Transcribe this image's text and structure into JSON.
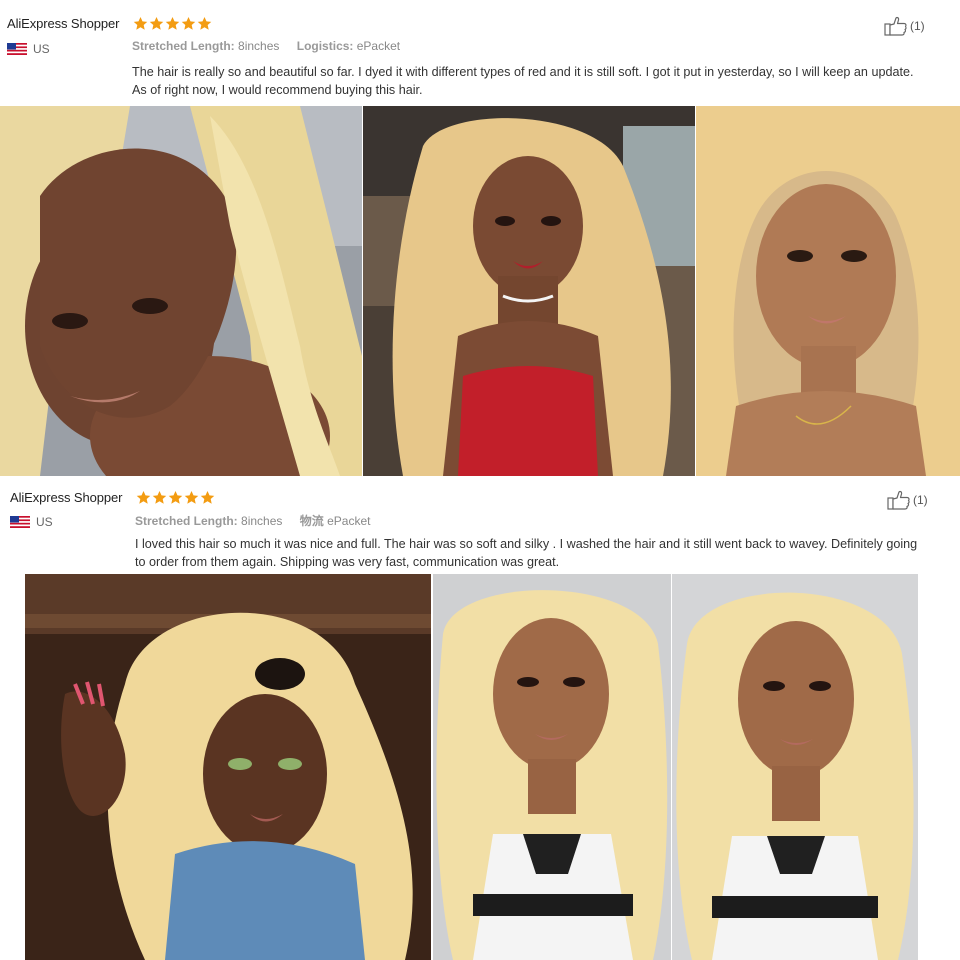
{
  "reviews": [
    {
      "reviewer": "AliExpress Shopper",
      "rating": 5,
      "country": "US",
      "details": [
        {
          "label": "Stretched Length:",
          "value": "8inches"
        },
        {
          "label": "Logistics:",
          "value": "ePacket"
        }
      ],
      "text": "The hair is really so and beautiful so far. I dyed it with different types of red and it is still soft. I got it put in yesterday, so I will keep an update. As of right now, I would recommend buying this hair.",
      "helpful_count": "(1)"
    },
    {
      "reviewer": "AliExpress Shopper",
      "rating": 5,
      "country": "US",
      "details": [
        {
          "label": "Stretched Length:",
          "value": "8inches"
        },
        {
          "label": "物流",
          "value": "ePacket"
        }
      ],
      "text": "I loved this hair so much it was nice and full. The hair was so soft and silky . I washed the hair and it still went back to wavey. Definitely going to order from them again. Shipping was very fast, communication was great.",
      "helpful_count": "(1)"
    }
  ],
  "colors": {
    "star": "#f5a623",
    "hair_blonde": "#f1dea0",
    "skin": "#8a5a3c"
  }
}
